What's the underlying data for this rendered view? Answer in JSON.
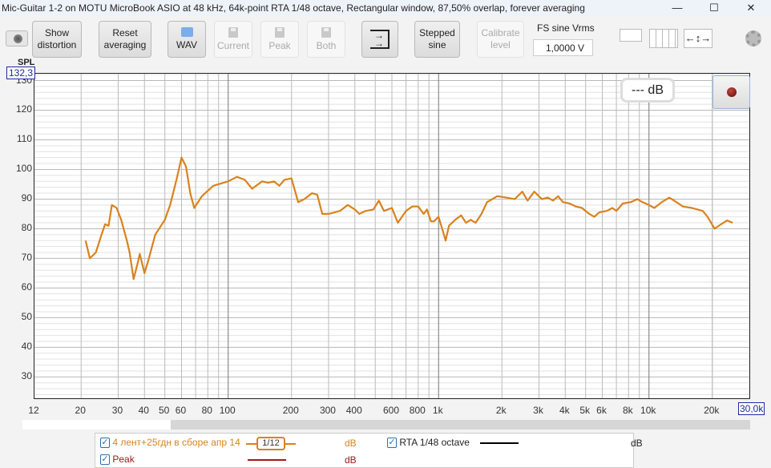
{
  "window": {
    "title": "Mic-Guitar 1-2 on MOTU MicroBook ASIO at 48 kHz, 64k-point RTA 1/48 octave, Rectangular window, 87,50% overlap, forever averaging",
    "minimize": "—",
    "maximize": "☐",
    "close": "✕"
  },
  "toolbar": {
    "show_distortion": [
      "Show",
      "distortion"
    ],
    "reset_averaging": [
      "Reset",
      "averaging"
    ],
    "wav": "WAV",
    "current": "Current",
    "peak": "Peak",
    "both": "Both",
    "stepped_sine": [
      "Stepped",
      "sine"
    ],
    "calibrate_level": [
      "Calibrate",
      "level"
    ],
    "fs_label": "FS sine Vrms",
    "fs_value": "1,0000 V"
  },
  "plot": {
    "y_title": "SPL",
    "y_max_readout": "132,3",
    "x_max_readout": "30,0k",
    "level_readout": "--- dB",
    "trace_color": "#d9821e",
    "peak_color": "#a01818"
  },
  "chart_data": {
    "type": "line",
    "xscale": "log",
    "xlim": [
      12,
      30000
    ],
    "ylim": [
      22.8,
      132.3
    ],
    "ylabel": "SPL",
    "yticks": [
      30,
      40,
      50,
      60,
      70,
      80,
      90,
      100,
      110,
      120,
      130
    ],
    "xticks": [
      {
        "v": 12,
        "l": "12"
      },
      {
        "v": 20,
        "l": "20"
      },
      {
        "v": 30,
        "l": "30"
      },
      {
        "v": 40,
        "l": "40"
      },
      {
        "v": 50,
        "l": "50"
      },
      {
        "v": 60,
        "l": "60"
      },
      {
        "v": 80,
        "l": "80"
      },
      {
        "v": 100,
        "l": "100"
      },
      {
        "v": 200,
        "l": "200"
      },
      {
        "v": 300,
        "l": "300"
      },
      {
        "v": 400,
        "l": "400"
      },
      {
        "v": 600,
        "l": "600"
      },
      {
        "v": 800,
        "l": "800"
      },
      {
        "v": 1000,
        "l": "1k"
      },
      {
        "v": 2000,
        "l": "2k"
      },
      {
        "v": 3000,
        "l": "3k"
      },
      {
        "v": 4000,
        "l": "4k"
      },
      {
        "v": 5000,
        "l": "5k"
      },
      {
        "v": 6000,
        "l": "6k"
      },
      {
        "v": 8000,
        "l": "8k"
      },
      {
        "v": 10000,
        "l": "10k"
      },
      {
        "v": 20000,
        "l": "20k"
      }
    ],
    "series": [
      {
        "name": "4 лент+25гдн  в сборе апр 14",
        "smoothing": "1/12",
        "x": [
          21,
          22,
          23.5,
          25,
          26,
          27,
          28,
          29.5,
          31,
          33,
          34,
          35.5,
          37,
          38,
          40,
          42,
          45,
          50,
          53,
          57,
          60,
          63,
          66,
          69,
          75,
          85,
          100,
          110,
          120,
          130,
          145,
          155,
          165,
          175,
          185,
          200,
          215,
          230,
          250,
          265,
          280,
          300,
          320,
          340,
          370,
          400,
          420,
          450,
          490,
          520,
          550,
          600,
          640,
          700,
          750,
          800,
          850,
          880,
          920,
          950,
          1000,
          1050,
          1080,
          1120,
          1200,
          1280,
          1350,
          1420,
          1500,
          1600,
          1700,
          1800,
          1900,
          2100,
          2300,
          2500,
          2650,
          2850,
          3100,
          3300,
          3500,
          3700,
          3900,
          4200,
          4500,
          4800,
          5200,
          5500,
          5800,
          6300,
          6700,
          7000,
          7500,
          8200,
          8800,
          9300,
          10000,
          10600,
          11500,
          12500,
          13500,
          14500,
          16000,
          18000,
          19000,
          20500,
          22000,
          23500,
          25000
        ],
        "y": [
          76,
          70,
          72,
          78,
          81.5,
          81,
          88,
          87,
          83,
          76,
          72,
          63,
          68,
          71.5,
          65,
          70,
          78,
          83,
          88,
          97,
          104,
          101,
          92,
          87,
          91,
          94.5,
          96,
          97.5,
          96.5,
          93.5,
          96,
          95.5,
          96,
          94.5,
          96.5,
          97,
          89,
          90,
          92,
          91.5,
          85,
          85,
          85.5,
          86,
          88,
          86.5,
          85,
          86,
          86.5,
          89.5,
          86,
          87,
          82,
          86,
          87.5,
          87.5,
          85,
          86.5,
          82.5,
          82.5,
          84,
          79,
          76,
          81,
          83,
          84.5,
          82,
          83,
          82,
          85,
          89,
          90,
          91,
          90.5,
          90,
          92.5,
          89.5,
          92.5,
          90,
          90.5,
          89.5,
          91,
          89,
          88.5,
          87.5,
          87,
          85,
          84,
          85.5,
          86,
          87,
          86,
          88.5,
          89,
          90,
          89,
          88,
          87,
          89,
          90.5,
          89,
          87.5,
          87,
          86,
          84,
          80,
          81.5,
          82.8,
          82
        ]
      }
    ]
  },
  "legend": {
    "items": [
      {
        "label": "4 лент+25гдн  в сборе апр 14",
        "smoothing": "1/12",
        "unit": "dB",
        "checked": "✓"
      },
      {
        "label": "RTA 1/48 octave",
        "unit": "dB",
        "checked": "✓"
      },
      {
        "label": "Peak",
        "unit": "dB",
        "checked": "✓"
      }
    ]
  }
}
